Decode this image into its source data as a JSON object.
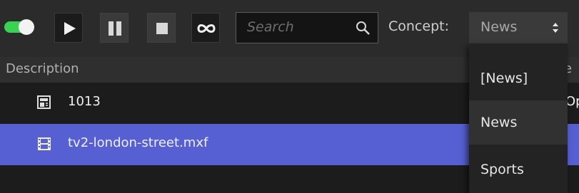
{
  "toolbar": {
    "toggle": {
      "state": "on",
      "color": "#39d353"
    },
    "buttons": [
      {
        "name": "play",
        "icon": "play-icon"
      },
      {
        "name": "pause",
        "icon": "pause-icon"
      },
      {
        "name": "stop",
        "icon": "stop-icon"
      },
      {
        "name": "loop",
        "icon": "infinity-icon"
      }
    ],
    "search": {
      "placeholder": "Search",
      "icon": "search-icon"
    },
    "concept": {
      "label": "Concept:",
      "selected": "News"
    }
  },
  "table": {
    "columns": [
      "Description",
      "e"
    ],
    "rows": [
      {
        "icon": "template-icon",
        "description": "1013",
        "second": "Op",
        "selected": false
      },
      {
        "icon": "film-icon",
        "description": "tv2-london-street.mxf",
        "second": "",
        "selected": true
      }
    ],
    "selection_color": "#5660d3"
  },
  "concept_dropdown": {
    "options": [
      "[News]",
      "News",
      "Sports"
    ],
    "highlighted": "News"
  }
}
